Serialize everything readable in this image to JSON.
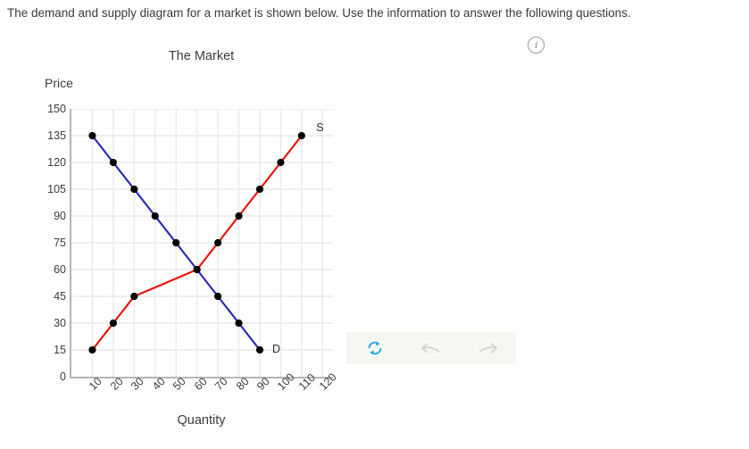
{
  "prompt": {
    "text": "The demand and supply diagram for a market is shown below. Use the information to answer the following questions."
  },
  "info_button": {
    "name": "info-icon",
    "glyph": "i"
  },
  "toolbar": {
    "buttons": [
      {
        "name": "reset-icon",
        "label": "reset",
        "color": "#1ba3e0"
      },
      {
        "name": "undo-icon",
        "label": "undo",
        "color": "#d3d3d3"
      },
      {
        "name": "redo-icon",
        "label": "redo",
        "color": "#d3d3d3"
      }
    ],
    "background": "#f7f7f2"
  },
  "chart_data": {
    "type": "line",
    "title": "The Market",
    "xlabel": "Quantity",
    "ylabel": "Price",
    "xlim": [
      0,
      125
    ],
    "ylim": [
      0,
      150
    ],
    "grid": true,
    "legend_position": "inline-endpoint-labels",
    "xticks": [
      "10",
      "20",
      "30",
      "40",
      "50",
      "60",
      "70",
      "80",
      "90",
      "100",
      "110",
      "120"
    ],
    "xtick_values": [
      10,
      20,
      30,
      40,
      50,
      60,
      70,
      80,
      90,
      100,
      110,
      120
    ],
    "yticks": [
      "0",
      "15",
      "30",
      "45",
      "60",
      "75",
      "90",
      "105",
      "120",
      "135",
      "150"
    ],
    "ytick_values": [
      0,
      15,
      30,
      45,
      60,
      75,
      90,
      105,
      120,
      135,
      150
    ],
    "series": [
      {
        "name": "D",
        "label": "D",
        "color": "#2a2ab5",
        "marker": "circle",
        "marker_color": "#000000",
        "x": [
          10,
          20,
          30,
          40,
          50,
          60,
          70,
          80,
          90
        ],
        "y": [
          135,
          120,
          105,
          90,
          75,
          60,
          45,
          30,
          15
        ],
        "label_at": {
          "x": 96,
          "y": 15
        }
      },
      {
        "name": "S",
        "label": "S",
        "color": "#e8140c",
        "marker": "circle",
        "marker_color": "#000000",
        "x": [
          10,
          20,
          30,
          40,
          50,
          60,
          70,
          80,
          90,
          100,
          110
        ],
        "y": [
          15,
          30,
          45,
          50,
          55,
          60,
          75,
          90,
          105,
          120,
          135
        ],
        "label_at": {
          "x": 117,
          "y": 139
        }
      }
    ],
    "equilibrium": {
      "quantity": 60,
      "price": 60
    }
  }
}
